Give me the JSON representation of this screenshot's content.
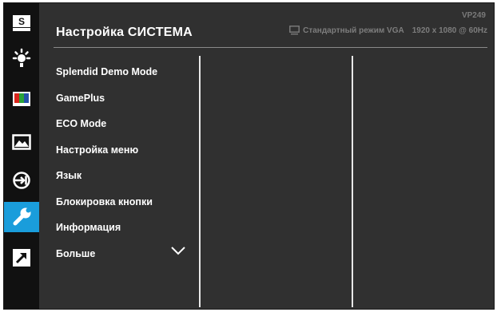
{
  "header": {
    "title": "Настройка СИСТЕМА",
    "model": "VP249",
    "status_mode": "Стандартный режим VGA",
    "status_resolution": "1920 x 1080 @ 60Hz"
  },
  "sidebar": {
    "items": [
      {
        "name": "splendid",
        "icon": "s-box-icon",
        "label": "S"
      },
      {
        "name": "brightness",
        "icon": "brightness-icon"
      },
      {
        "name": "color",
        "icon": "color-bars-icon"
      },
      {
        "name": "image",
        "icon": "image-mountain-icon"
      },
      {
        "name": "input",
        "icon": "input-select-icon"
      },
      {
        "name": "system",
        "icon": "wrench-icon",
        "active": true
      },
      {
        "name": "shortcut",
        "icon": "shortcut-arrow-icon"
      }
    ]
  },
  "menu": {
    "items": [
      "Splendid Demo Mode",
      "GamePlus",
      "ECO Mode",
      "Настройка меню",
      "Язык",
      "Блокировка кнопки",
      "Информация",
      "Больше"
    ]
  },
  "colors": {
    "background": "#303030",
    "sidebar": "#111111",
    "active": "#1a9ddb",
    "text": "#ffffff",
    "muted": "#7d7d7d"
  }
}
